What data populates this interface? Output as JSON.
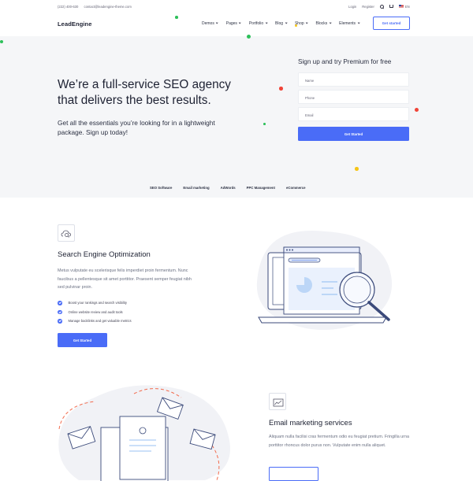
{
  "topbar": {
    "phone": "(222) 400-630",
    "email": "contact@leadengine-theme.com",
    "login": "Login",
    "register": "Register",
    "language": "EN"
  },
  "nav": {
    "logo": "LeadEngine",
    "items": [
      {
        "label": "Demos"
      },
      {
        "label": "Pages"
      },
      {
        "label": "Portfolio"
      },
      {
        "label": "Blog"
      },
      {
        "label": "Shop"
      },
      {
        "label": "Blocks"
      },
      {
        "label": "Elements"
      }
    ],
    "cta": "Get started"
  },
  "hero": {
    "title": "We’re a full-service SEO agency that delivers the best results.",
    "subtitle": "Get all the essentials you’re looking for in a lightweight package. Sign up today!",
    "form": {
      "title": "Sign up and try Premium for free",
      "name_placeholder": "Name",
      "phone_placeholder": "Phone",
      "email_placeholder": "Email",
      "button": "Get Started"
    }
  },
  "tabs": [
    "SEO Software",
    "Email marketing",
    "AdWords",
    "PPC Management",
    "eCommerce"
  ],
  "feature1": {
    "title": "Search Engine Optimization",
    "text": "Metus vulputate eu scelerisque felis imperdiet proin fermentum. Nunc faucibus a pellentesque sit amet porttitor. Praesent semper feugiat nibh sed pulvinar proin.",
    "checks": [
      "Boost your rankings and search visibility",
      "Online website review and audit tools",
      "Manage backlinks and get valuable metrics"
    ],
    "button": "Get Started"
  },
  "feature2": {
    "title": "Email marketing services",
    "text": "Aliquam nulla facilisi cras fermentum odio eu feugiat pretium. Fringilla urna porttitor rhoncus dolor purus non. Vulputate enim nulla aliquet."
  },
  "colors": {
    "accent": "#4a6cf7",
    "hero_bg": "#f5f6f8",
    "dot_green": "#2ec05a",
    "dot_red": "#f04438",
    "dot_yellow": "#f5c518"
  },
  "icons": [
    "search-icon",
    "cart-icon",
    "flag-icon",
    "cloud-search-icon",
    "envelope-chart-icon",
    "check-icon"
  ]
}
